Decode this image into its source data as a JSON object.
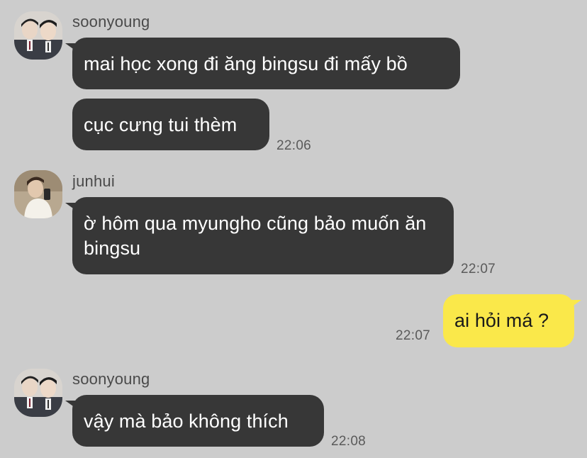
{
  "messages": [
    {
      "sender": "soonyoung",
      "avatar_icon": "two-boys-photo-avatar",
      "bubbles": [
        "mai học xong đi ăng bingsu đi mấy bồ",
        "cục cưng tui thèm"
      ],
      "time": "22:06"
    },
    {
      "sender": "junhui",
      "avatar_icon": "mirror-selfie-photo-avatar",
      "bubbles": [
        "ờ hôm qua myungho cũng bảo muốn ăn bingsu"
      ],
      "time": "22:07"
    },
    {
      "sender": "me",
      "bubbles": [
        "ai hỏi má ?"
      ],
      "time": "22:07"
    },
    {
      "sender": "soonyoung",
      "avatar_icon": "two-boys-photo-avatar",
      "bubbles": [
        "vậy mà bảo không thích"
      ],
      "time": "22:08"
    }
  ],
  "colors": {
    "background": "#cccccc",
    "received_bubble": "#373737",
    "sent_bubble": "#fae84a"
  }
}
